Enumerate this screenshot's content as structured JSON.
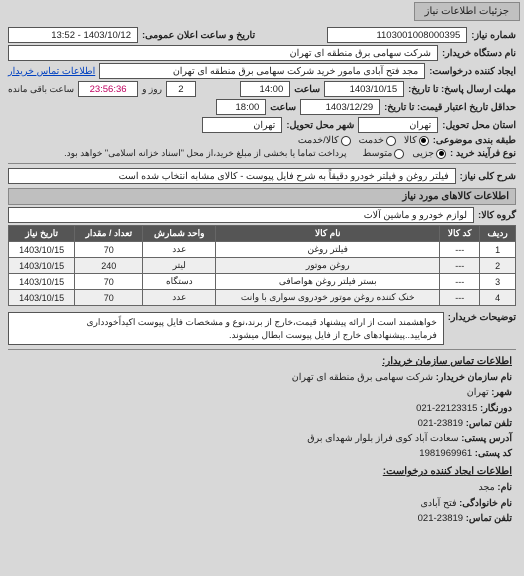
{
  "tab": "جزئیات اطلاعات نیاز",
  "fields": {
    "req_no_label": "شماره نیاز:",
    "req_no": "1103001008000395",
    "announce_label": "تاریخ و ساعت اعلان عمومی:",
    "announce": "1403/10/12 - 13:52",
    "buyer_label": "نام دستگاه خریدار:",
    "buyer": "شرکت سهامی برق منطقه ای تهران",
    "creator_label": "ایجاد کننده درخواست:",
    "creator": "مجد فتح آبادی مامور خرید شرکت سهامی برق منطقه ای تهران",
    "buyer_contact_link": "اطلاعات تماس خریدار",
    "deadline_label": "مهلت ارسال پاسخ: تا تاریخ:",
    "deadline_date": "1403/10/15",
    "time_label": "ساعت",
    "deadline_time": "14:00",
    "remain_days": "2",
    "remain_days_label": "روز و",
    "remain_time": "23:56:36",
    "remain_time_label": "ساعت باقی مانده",
    "validity_label": "حداقل تاریخ اعتبار قیمت: تا تاریخ:",
    "validity_date": "1403/12/29",
    "validity_time": "18:00",
    "delivery_state_label": "استان محل تحویل:",
    "delivery_state": "تهران",
    "delivery_city_label": "شهر محل تحویل:",
    "delivery_city": "تهران",
    "goods_type_label": "طبقه بندی موضوعی:",
    "opt_goods": "کالا",
    "opt_service": "خدمت",
    "opt_goods_service": "کالا/خدمت",
    "buy_type_label": "نوع فرآیند خرید :",
    "opt_small": "جزیی",
    "opt_medium": "متوسط",
    "pay_note": "پرداخت تماما یا بخشی از مبلغ خرید،از محل \"اسناد خزانه اسلامی\" خواهد بود.",
    "need_title_label": "شرح کلی نیاز:",
    "need_title": "فیلتر روغن و فیلتر خودرو دقیقاً به شرح فایل پیوست - کالای مشابه انتخاب شده است",
    "goods_info_header": "اطلاعات کالاهای مورد نیاز",
    "goods_group_label": "گروه کالا:",
    "goods_group": "لوازم خودرو و ماشین آلات",
    "desc_label": "توضیحات خریدار:",
    "desc": "خواهشمند است از ارائه پیشنهاد قیمت،خارج از برند،نوع و مشخصات فایل پیوست اکیداًخودداری فرمایید..پیشنهادهای خارج از فایل پیوست ابطال میشوند."
  },
  "table": {
    "headers": [
      "ردیف",
      "کد کالا",
      "نام کالا",
      "واحد شمارش",
      "تعداد / مقدار",
      "تاریخ نیاز"
    ],
    "rows": [
      [
        "1",
        "---",
        "فیلتر روغن",
        "عدد",
        "70",
        "1403/10/15"
      ],
      [
        "2",
        "---",
        "روغن موتور",
        "لیتر",
        "240",
        "1403/10/15"
      ],
      [
        "3",
        "---",
        "بستر فیلتر روغن هواصافی",
        "دستگاه",
        "70",
        "1403/10/15"
      ],
      [
        "4",
        "---",
        "خنک کننده روغن موتور خودروی سواری با وانت",
        "عدد",
        "70",
        "1403/10/15"
      ]
    ]
  },
  "contact": {
    "header": "اطلاعات تماس سازمان خریدار:",
    "org_label": "نام سازمان خریدار:",
    "org": "شرکت سهامی برق منطقه ای تهران",
    "city_label": "شهر:",
    "city": "تهران",
    "fax_label": "دورنگار:",
    "fax": "22123315-021",
    "phone_label": "تلفن تماس:",
    "phone": "23819-021",
    "addr_label": "آدرس پستی:",
    "addr": "سعادت آباد کوی فراز بلوار شهدای برق",
    "zip_label": "کد پستی:",
    "zip": "1981969961",
    "creator_header": "اطلاعات ایجاد کننده درخواست:",
    "name_label": "نام:",
    "name": "مجد",
    "lname_label": "نام خانوادگی:",
    "lname": "فتح آبادی",
    "cphone_label": "تلفن تماس:",
    "cphone": "23819-021"
  }
}
